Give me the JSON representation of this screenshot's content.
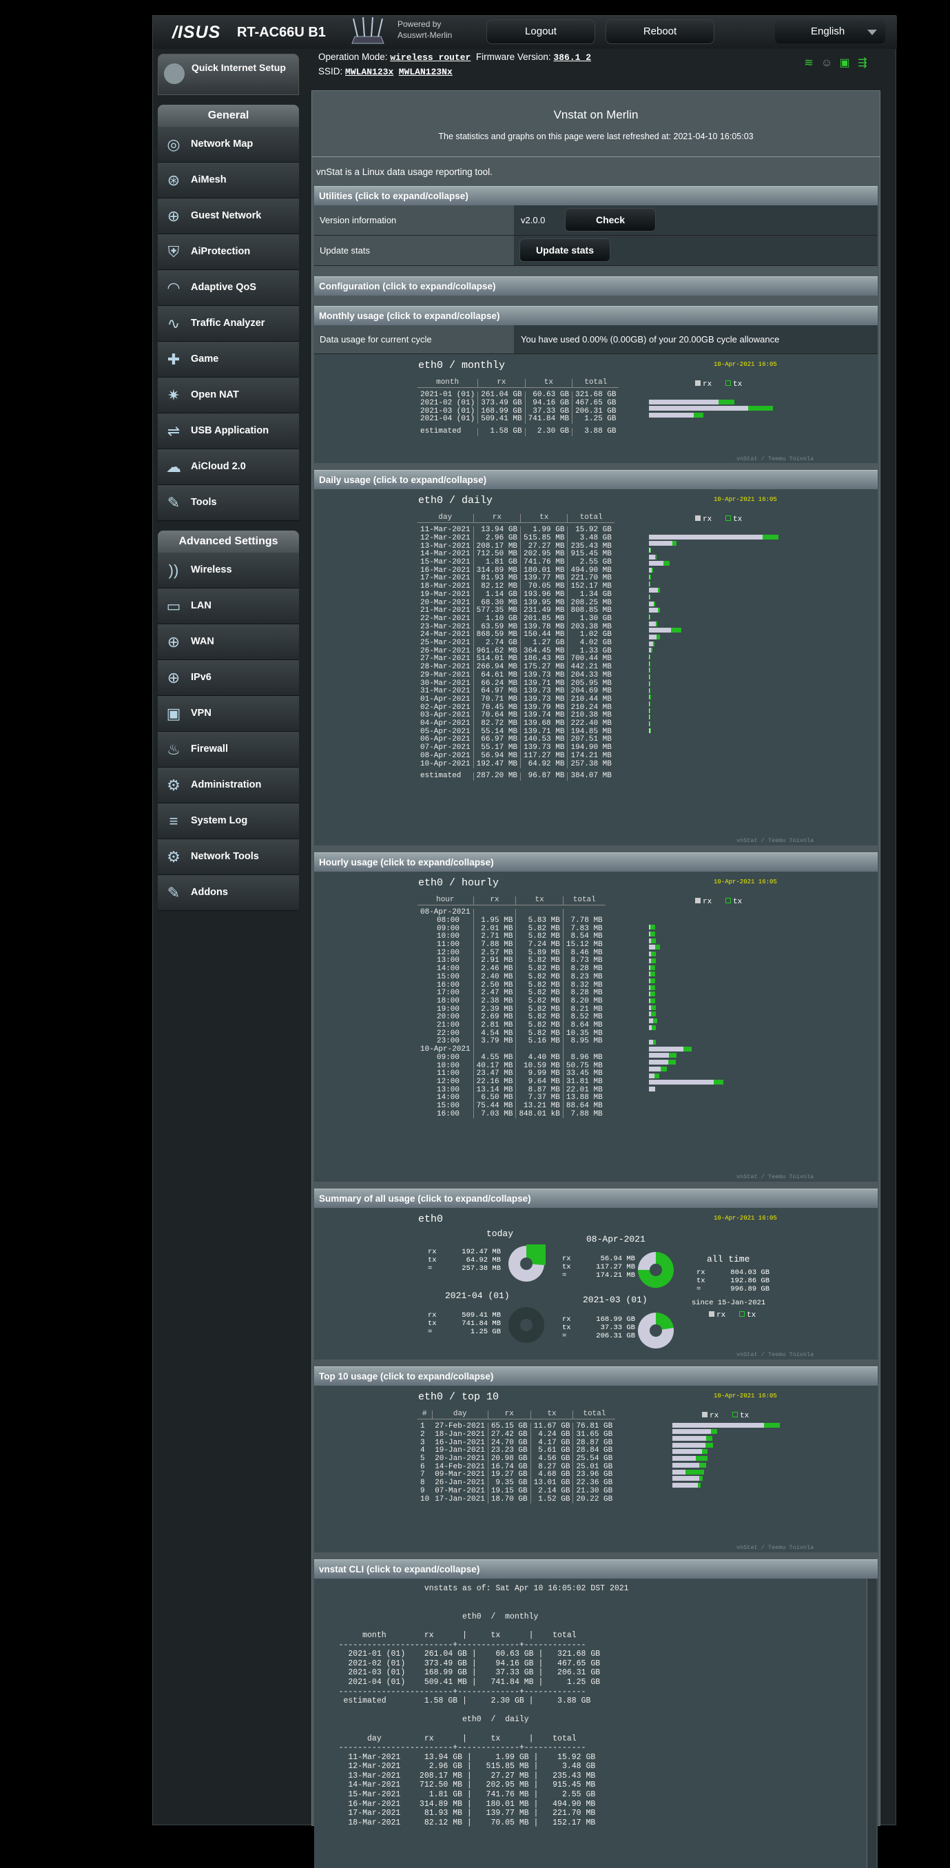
{
  "topbar": {
    "brand": "/ISUS",
    "model": "RT-AC66U B1",
    "powered": "Powered by",
    "firmware_name": "Asuswrt-Merlin",
    "logout": "Logout",
    "reboot": "Reboot",
    "language": "English"
  },
  "status": {
    "mode_label": "Operation Mode:",
    "mode_value": "wireless router",
    "fw_label": "Firmware Version:",
    "fw_value": "386.1_2",
    "ssid_label": "SSID:",
    "ssid1": "MWLAN123x",
    "ssid2": "MWLAN123Nx"
  },
  "sidebar": {
    "qis": "Quick Internet Setup",
    "general": "General",
    "general_items": [
      "Network Map",
      "AiMesh",
      "Guest Network",
      "AiProtection",
      "Adaptive QoS",
      "Traffic Analyzer",
      "Game",
      "Open NAT",
      "USB Application",
      "AiCloud 2.0",
      "Tools"
    ],
    "advanced": "Advanced Settings",
    "advanced_items": [
      "Wireless",
      "LAN",
      "WAN",
      "IPv6",
      "VPN",
      "Firewall",
      "Administration",
      "System Log",
      "Network Tools",
      "Addons"
    ]
  },
  "page": {
    "title": "Vnstat on Merlin",
    "subtitle": "The statistics and graphs on this page were last refreshed at: 2021-04-10 16:05:03",
    "intro": "vnStat is a Linux data usage reporting tool."
  },
  "utilities": {
    "header": "Utilities (click to expand/collapse)",
    "version_label": "Version information",
    "version_value": "v2.0.0",
    "check": "Check",
    "update_label": "Update stats",
    "update_button": "Update stats"
  },
  "configuration": {
    "header": "Configuration (click to expand/collapse)"
  },
  "monthly": {
    "header": "Monthly usage (click to expand/collapse)",
    "cycle_label": "Data usage for current cycle",
    "cycle_value": "You have used 0.00% (0.00GB) of your 20.00GB cycle allowance",
    "title": "eth0  /  monthly",
    "date": "10-Apr-2021 16:05",
    "cols": [
      "month",
      "rx",
      "tx",
      "total"
    ],
    "rows": [
      [
        "2021-01 (01)",
        "261.04 GB",
        "60.63 GB",
        "321.68 GB",
        0.56,
        0.13
      ],
      [
        "2021-02 (01)",
        "373.49 GB",
        "94.16 GB",
        "467.65 GB",
        0.8,
        0.2
      ],
      [
        "2021-03 (01)",
        "168.99 GB",
        "37.33 GB",
        "206.31 GB",
        0.36,
        0.08
      ],
      [
        "2021-04 (01)",
        "509.41 MB",
        "741.84 MB",
        "1.25 GB",
        0.0,
        0.0
      ]
    ],
    "est": [
      "estimated",
      "1.58 GB",
      "2.30 GB",
      "3.88 GB"
    ],
    "credit": "vnStat / Teemu Toivola"
  },
  "daily": {
    "header": "Daily usage (click to expand/collapse)",
    "title": "eth0  /  daily",
    "date": "10-Apr-2021 16:05",
    "cols": [
      "day",
      "rx",
      "tx",
      "total"
    ],
    "rows": [
      [
        "11-Mar-2021",
        "13.94 GB",
        "1.99 GB",
        "15.92 GB",
        0.87,
        0.12
      ],
      [
        "12-Mar-2021",
        "2.96 GB",
        "515.85 MB",
        "3.48 GB",
        0.18,
        0.03
      ],
      [
        "13-Mar-2021",
        "208.17 MB",
        "27.27 MB",
        "235.43 MB",
        0.013,
        0.002
      ],
      [
        "14-Mar-2021",
        "712.50 MB",
        "202.95 MB",
        "915.45 MB",
        0.045,
        0.013
      ],
      [
        "15-Mar-2021",
        "1.81 GB",
        "741.76 MB",
        "2.55 GB",
        0.11,
        0.046
      ],
      [
        "16-Mar-2021",
        "314.89 MB",
        "180.01 MB",
        "494.90 MB",
        0.02,
        0.011
      ],
      [
        "17-Mar-2021",
        "81.93 MB",
        "139.77 MB",
        "221.70 MB",
        0.005,
        0.009
      ],
      [
        "18-Mar-2021",
        "82.12 MB",
        "70.05 MB",
        "152.17 MB",
        0.005,
        0.004
      ],
      [
        "19-Mar-2021",
        "1.14 GB",
        "193.96 MB",
        "1.34 GB",
        0.07,
        0.012
      ],
      [
        "20-Mar-2021",
        "68.30 MB",
        "139.95 MB",
        "208.25 MB",
        0.004,
        0.009
      ],
      [
        "21-Mar-2021",
        "577.35 MB",
        "231.49 MB",
        "808.85 MB",
        0.036,
        0.014
      ],
      [
        "22-Mar-2021",
        "1.10 GB",
        "201.85 MB",
        "1.30 GB",
        0.069,
        0.013
      ],
      [
        "23-Mar-2021",
        "63.59 MB",
        "139.78 MB",
        "203.38 MB",
        0.004,
        0.009
      ],
      [
        "24-Mar-2021",
        "868.59 MB",
        "150.44 MB",
        "1.02 GB",
        0.054,
        0.009
      ],
      [
        "25-Mar-2021",
        "2.74 GB",
        "1.27 GB",
        "4.02 GB",
        0.17,
        0.08
      ],
      [
        "26-Mar-2021",
        "961.62 MB",
        "364.45 MB",
        "1.33 GB",
        0.06,
        0.023
      ],
      [
        "27-Mar-2021",
        "514.01 MB",
        "186.43 MB",
        "700.44 MB",
        0.032,
        0.012
      ],
      [
        "28-Mar-2021",
        "266.94 MB",
        "175.27 MB",
        "442.21 MB",
        0.017,
        0.011
      ],
      [
        "29-Mar-2021",
        "64.61 MB",
        "139.73 MB",
        "204.33 MB",
        0.004,
        0.009
      ],
      [
        "30-Mar-2021",
        "66.24 MB",
        "139.71 MB",
        "205.95 MB",
        0.004,
        0.009
      ],
      [
        "31-Mar-2021",
        "64.97 MB",
        "139.73 MB",
        "204.69 MB",
        0.004,
        0.009
      ],
      [
        "01-Apr-2021",
        "70.71 MB",
        "139.73 MB",
        "210.44 MB",
        0.004,
        0.009
      ],
      [
        "02-Apr-2021",
        "70.45 MB",
        "139.79 MB",
        "210.24 MB",
        0.004,
        0.009
      ],
      [
        "03-Apr-2021",
        "70.64 MB",
        "139.74 MB",
        "210.38 MB",
        0.004,
        0.009
      ],
      [
        "04-Apr-2021",
        "82.72 MB",
        "139.68 MB",
        "222.40 MB",
        0.005,
        0.009
      ],
      [
        "05-Apr-2021",
        "55.14 MB",
        "139.71 MB",
        "194.85 MB",
        0.003,
        0.009
      ],
      [
        "06-Apr-2021",
        "66.97 MB",
        "140.53 MB",
        "207.51 MB",
        0.004,
        0.009
      ],
      [
        "07-Apr-2021",
        "55.17 MB",
        "139.73 MB",
        "194.90 MB",
        0.003,
        0.009
      ],
      [
        "08-Apr-2021",
        "56.94 MB",
        "117.27 MB",
        "174.21 MB",
        0.004,
        0.007
      ],
      [
        "10-Apr-2021",
        "192.47 MB",
        "64.92 MB",
        "257.38 MB",
        0.012,
        0.004
      ]
    ],
    "est": [
      "estimated",
      "287.20 MB",
      "96.87 MB",
      "384.07 MB"
    ],
    "credit": "vnStat / Teemu Toivola"
  },
  "hourly": {
    "header": "Hourly usage (click to expand/collapse)",
    "title": "eth0  /  hourly",
    "date": "10-Apr-2021 16:05",
    "cols": [
      "hour",
      "rx",
      "tx",
      "total"
    ],
    "day1": "08-Apr-2021",
    "day2": "10-Apr-2021",
    "rows1": [
      [
        "08:00",
        "1.95 MB",
        "5.83 MB",
        "7.78 MB",
        0.02,
        0.06
      ],
      [
        "09:00",
        "2.01 MB",
        "5.82 MB",
        "7.83 MB",
        0.02,
        0.06
      ],
      [
        "10:00",
        "2.71 MB",
        "5.82 MB",
        "8.54 MB",
        0.03,
        0.06
      ],
      [
        "11:00",
        "7.88 MB",
        "7.24 MB",
        "15.12 MB",
        0.08,
        0.07
      ],
      [
        "12:00",
        "2.57 MB",
        "5.89 MB",
        "8.46 MB",
        0.03,
        0.06
      ],
      [
        "13:00",
        "2.91 MB",
        "5.82 MB",
        "8.73 MB",
        0.03,
        0.06
      ],
      [
        "14:00",
        "2.46 MB",
        "5.82 MB",
        "8.28 MB",
        0.02,
        0.06
      ],
      [
        "15:00",
        "2.40 MB",
        "5.82 MB",
        "8.23 MB",
        0.02,
        0.06
      ],
      [
        "16:00",
        "2.50 MB",
        "5.82 MB",
        "8.32 MB",
        0.02,
        0.06
      ],
      [
        "17:00",
        "2.47 MB",
        "5.82 MB",
        "8.28 MB",
        0.02,
        0.06
      ],
      [
        "18:00",
        "2.38 MB",
        "5.82 MB",
        "8.20 MB",
        0.02,
        0.06
      ],
      [
        "19:00",
        "2.39 MB",
        "5.82 MB",
        "8.21 MB",
        0.02,
        0.06
      ],
      [
        "20:00",
        "2.69 MB",
        "5.82 MB",
        "8.52 MB",
        0.03,
        0.06
      ],
      [
        "21:00",
        "2.81 MB",
        "5.82 MB",
        "8.64 MB",
        0.03,
        0.06
      ],
      [
        "22:00",
        "4.54 MB",
        "5.82 MB",
        "10.35 MB",
        0.05,
        0.06
      ],
      [
        "23:00",
        "3.79 MB",
        "5.16 MB",
        "8.95 MB",
        0.04,
        0.05
      ]
    ],
    "rows2": [
      [
        "09:00",
        "4.55 MB",
        "4.40 MB",
        "8.96 MB",
        0.05,
        0.04
      ],
      [
        "10:00",
        "40.17 MB",
        "10.59 MB",
        "50.75 MB",
        0.45,
        0.11
      ],
      [
        "11:00",
        "23.47 MB",
        "9.99 MB",
        "33.45 MB",
        0.26,
        0.1
      ],
      [
        "12:00",
        "22.16 MB",
        "9.64 MB",
        "31.81 MB",
        0.25,
        0.1
      ],
      [
        "13:00",
        "13.14 MB",
        "8.87 MB",
        "22.01 MB",
        0.15,
        0.09
      ],
      [
        "14:00",
        "6.50 MB",
        "7.37 MB",
        "13.88 MB",
        0.07,
        0.07
      ],
      [
        "15:00",
        "75.44 MB",
        "13.21 MB",
        "88.64 MB",
        0.85,
        0.13
      ],
      [
        "16:00",
        "7.03 MB",
        "848.01 kB",
        "7.88 MB",
        0.08,
        0.0
      ]
    ],
    "credit": "vnStat / Teemu Toivola"
  },
  "summary": {
    "header": "Summary of all usage (click to expand/collapse)",
    "iface": "eth0",
    "date": "10-Apr-2021 16:05",
    "today_label": "today",
    "today": [
      "192.47 MB",
      "64.92 MB",
      "257.38 MB"
    ],
    "yday_label": "08-Apr-2021",
    "yday": [
      "56.94 MB",
      "117.27 MB",
      "174.21 MB"
    ],
    "alltime_label": "all time",
    "alltime": [
      "804.03 GB",
      "192.86 GB",
      "996.89 GB"
    ],
    "since": "since 15-Jan-2021",
    "month_label": "2021-04 (01)",
    "month": [
      "509.41 MB",
      "741.84 MB",
      "1.25 GB"
    ],
    "prev_label": "2021-03 (01)",
    "prev": [
      "168.99 GB",
      "37.33 GB",
      "206.31 GB"
    ],
    "rx": "rx",
    "tx": "tx",
    "eq": "=",
    "credit": "vnStat / Teemu Toivola"
  },
  "top10": {
    "header": "Top 10 usage (click to expand/collapse)",
    "title": "eth0  /  top 10",
    "date": "10-Apr-2021 16:05",
    "cols": [
      "#",
      "day",
      "rx",
      "tx",
      "total"
    ],
    "rows": [
      [
        "1",
        "27-Feb-2021",
        "65.15 GB",
        "11.67 GB",
        "76.81 GB",
        0.78,
        0.14
      ],
      [
        "2",
        "18-Jan-2021",
        "27.42 GB",
        "4.24 GB",
        "31.65 GB",
        0.33,
        0.05
      ],
      [
        "3",
        "16-Jan-2021",
        "24.70 GB",
        "4.17 GB",
        "28.87 GB",
        0.29,
        0.05
      ],
      [
        "4",
        "19-Jan-2021",
        "23.23 GB",
        "5.61 GB",
        "28.84 GB",
        0.28,
        0.07
      ],
      [
        "5",
        "20-Jan-2021",
        "20.98 GB",
        "4.56 GB",
        "25.54 GB",
        0.25,
        0.05
      ],
      [
        "6",
        "14-Feb-2021",
        "16.74 GB",
        "8.27 GB",
        "25.01 GB",
        0.2,
        0.1
      ],
      [
        "7",
        "09-Mar-2021",
        "19.27 GB",
        "4.68 GB",
        "23.96 GB",
        0.23,
        0.06
      ],
      [
        "8",
        "26-Jan-2021",
        "9.35 GB",
        "13.01 GB",
        "22.36 GB",
        0.11,
        0.16
      ],
      [
        "9",
        "07-Mar-2021",
        "19.15 GB",
        "2.14 GB",
        "21.30 GB",
        0.23,
        0.03
      ],
      [
        "10",
        "17-Jan-2021",
        "18.70 GB",
        "1.52 GB",
        "20.22 GB",
        0.22,
        0.02
      ]
    ],
    "credit": "vnStat / Teemu Toivola"
  },
  "cli": {
    "header": "vnstat CLI (click to expand/collapse)",
    "text": "                      vnstats as of: Sat Apr 10 16:05:02 DST 2021\n\n\n                              eth0  /  monthly\n\n         month        rx      |     tx      |    total\n    ------------------------+-------------+-------------\n      2021-01 (01)    261.04 GB |    60.63 GB |   321.68 GB\n      2021-02 (01)    373.49 GB |    94.16 GB |   467.65 GB\n      2021-03 (01)    168.99 GB |    37.33 GB |   206.31 GB\n      2021-04 (01)    509.41 MB |   741.84 MB |     1.25 GB\n    ------------------------+-------------+-------------\n     estimated        1.58 GB |     2.30 GB |     3.88 GB\n\n                              eth0  /  daily\n\n          day         rx      |     tx      |    total\n    ------------------------+-------------+-------------\n      11-Mar-2021     13.94 GB |     1.99 GB |    15.92 GB\n      12-Mar-2021      2.96 GB |   515.85 MB |     3.48 GB\n      13-Mar-2021    208.17 MB |    27.27 MB |   235.43 MB\n      14-Mar-2021    712.50 MB |   202.95 MB |   915.45 MB\n      15-Mar-2021      1.81 GB |   741.76 MB |     2.55 GB\n      16-Mar-2021    314.89 MB |   180.01 MB |   494.90 MB\n      17-Mar-2021     81.93 MB |   139.77 MB |   221.70 MB\n      18-Mar-2021     82.12 MB |    70.05 MB |   152.17 MB"
  },
  "colors": {
    "rx": "#ccccdd",
    "tx": "#22bb22",
    "accent": "#ffee00"
  }
}
